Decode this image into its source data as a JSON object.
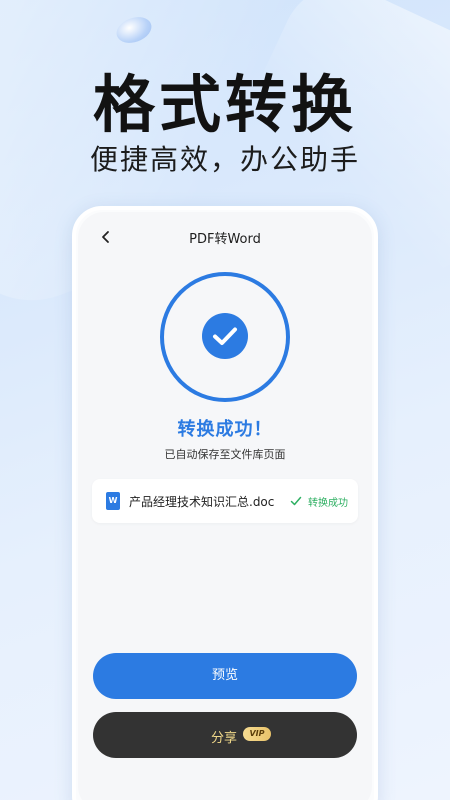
{
  "promo": {
    "headline": "格式转换",
    "subline": "便捷高效，办公助手"
  },
  "screen": {
    "back_icon": "chevron-left-icon",
    "title": "PDF转Word",
    "status_icon": "check-circle-icon",
    "success_text": "转换成功！",
    "saved_text": "已自动保存至文件库页面",
    "file": {
      "icon": "word-doc-icon",
      "icon_letter": "W",
      "name": "产品经理技术知识汇总.doc",
      "status_icon": "check-icon",
      "status": "转换成功"
    },
    "preview_label": "预览",
    "share_label": "分享",
    "vip_badge": "VIP"
  },
  "colors": {
    "accent": "#2c7be2",
    "success_green": "#2eaf62",
    "dark_button": "#333333",
    "vip_gold": "#e9c36a"
  }
}
